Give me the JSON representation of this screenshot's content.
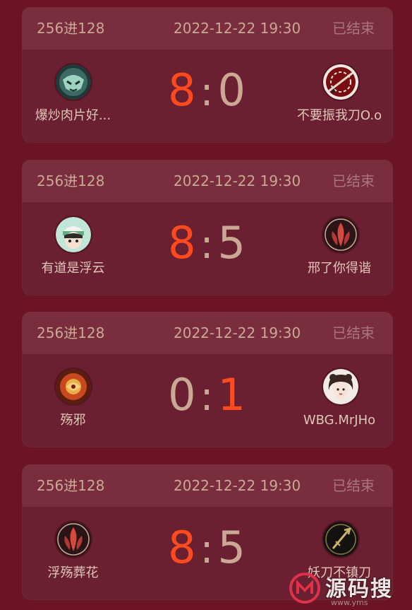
{
  "matches": [
    {
      "round": "256进128",
      "time": "2022-12-22 19:30",
      "status": "已结束",
      "left": {
        "name": "爆炒肉片好...",
        "score": "8"
      },
      "right": {
        "name": "不要振我刀O.o",
        "score": "0"
      },
      "winner": "left"
    },
    {
      "round": "256进128",
      "time": "2022-12-22 19:30",
      "status": "已结束",
      "left": {
        "name": "有道是浮云",
        "score": "8"
      },
      "right": {
        "name": "邢了你得谐",
        "score": "5"
      },
      "winner": "left"
    },
    {
      "round": "256进128",
      "time": "2022-12-22 19:30",
      "status": "已结束",
      "left": {
        "name": "殇邪",
        "score": "0"
      },
      "right": {
        "name": "WBG.MrJHo",
        "score": "1"
      },
      "winner": "right"
    },
    {
      "round": "256进128",
      "time": "2022-12-22 19:30",
      "status": "已结束",
      "left": {
        "name": "浮殇葬花",
        "score": "8"
      },
      "right": {
        "name": "妖刀不镇刀",
        "score": "5"
      },
      "winner": "left"
    }
  ],
  "score_separator": ":",
  "watermark": {
    "text": "源码搜",
    "url": "www.yms"
  },
  "colors": {
    "win": "#ff4a1e",
    "lose": "#c9a993",
    "background": "#6a1424"
  }
}
